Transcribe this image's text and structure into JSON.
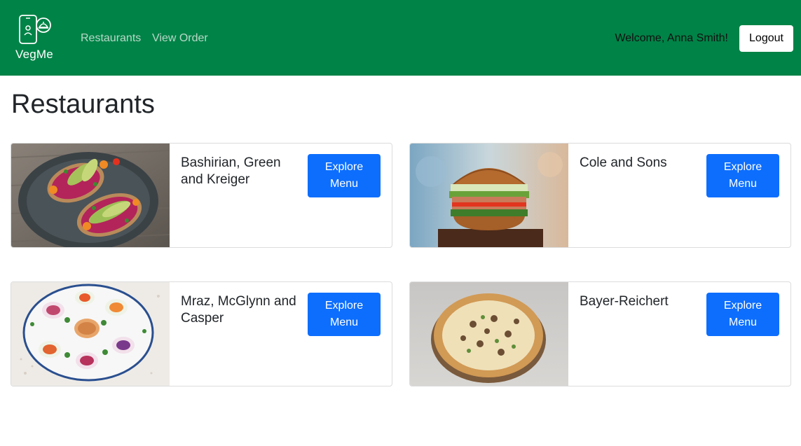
{
  "navbar": {
    "brand_name": "VegMe",
    "brand_icon": "phone-cloche-icon",
    "links": [
      {
        "label": "Restaurants"
      },
      {
        "label": "View Order"
      }
    ],
    "welcome_text": "Welcome, Anna Smith!",
    "logout_label": "Logout",
    "background_color": "#008347"
  },
  "page": {
    "title": "Restaurants"
  },
  "restaurants": [
    {
      "name": "Bashirian, Green and Kreiger",
      "button_label": "Explore Menu",
      "image": "avocado-toast-photo"
    },
    {
      "name": "Cole and Sons",
      "button_label": "Explore Menu",
      "image": "veggie-burger-photo"
    },
    {
      "name": "Mraz, McGlynn and Casper",
      "button_label": "Explore Menu",
      "image": "spring-rolls-photo"
    },
    {
      "name": "Bayer-Reichert",
      "button_label": "Explore Menu",
      "image": "pizza-photo"
    }
  ],
  "colors": {
    "primary_button": "#0d6efd",
    "nav_link": "#b9d8c8"
  }
}
